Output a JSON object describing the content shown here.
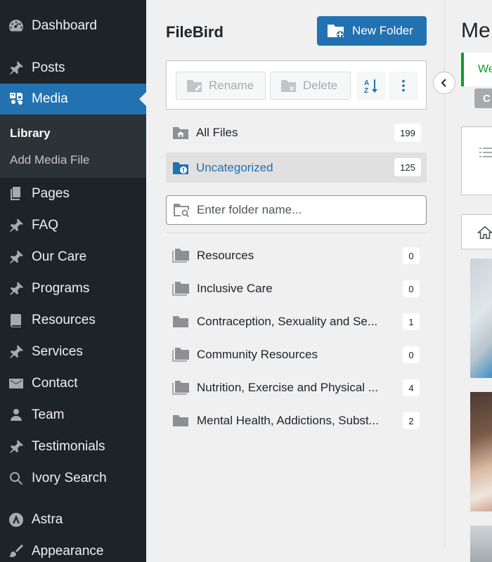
{
  "admin_menu": {
    "items": [
      {
        "label": "Dashboard",
        "icon": "dashboard-icon"
      },
      {
        "label": "Posts",
        "icon": "pin-icon"
      },
      {
        "label": "Media",
        "icon": "media-icon"
      },
      {
        "label": "Pages",
        "icon": "pages-icon"
      },
      {
        "label": "FAQ",
        "icon": "pin-icon"
      },
      {
        "label": "Our Care",
        "icon": "pin-icon"
      },
      {
        "label": "Programs",
        "icon": "pin-icon"
      },
      {
        "label": "Resources",
        "icon": "book-icon"
      },
      {
        "label": "Services",
        "icon": "pin-icon"
      },
      {
        "label": "Contact",
        "icon": "mail-icon"
      },
      {
        "label": "Team",
        "icon": "user-icon"
      },
      {
        "label": "Testimonials",
        "icon": "pin-icon"
      },
      {
        "label": "Ivory Search",
        "icon": "search-icon"
      },
      {
        "label": "Astra",
        "icon": "astra-icon"
      },
      {
        "label": "Appearance",
        "icon": "brush-icon"
      }
    ],
    "active": "Media",
    "submenu": [
      {
        "label": "Library",
        "current": true
      },
      {
        "label": "Add Media File",
        "current": false
      }
    ]
  },
  "filebird": {
    "title": "FileBird",
    "new_folder_label": "New Folder",
    "toolbar": {
      "rename_label": "Rename",
      "delete_label": "Delete",
      "sort_icon": "sort-az-icon",
      "more_icon": "more-vertical-icon"
    },
    "all_files": {
      "label": "All Files",
      "count": "199"
    },
    "uncategorized": {
      "label": "Uncategorized",
      "count": "125"
    },
    "search_placeholder": "Enter folder name...",
    "folders": [
      {
        "name": "Resources",
        "count": "0"
      },
      {
        "name": "Inclusive Care",
        "count": "0"
      },
      {
        "name": "Contraception, Sexuality and Se...",
        "count": "1"
      },
      {
        "name": "Community Resources",
        "count": "0"
      },
      {
        "name": "Nutrition, Exercise and Physical ...",
        "count": "4"
      },
      {
        "name": "Mental Health, Addictions, Subst...",
        "count": "2"
      }
    ]
  },
  "media_area": {
    "title_partial": "Me",
    "notice_partial": "We",
    "pill_partial": "C"
  },
  "colors": {
    "admin_bg": "#1d2327",
    "accent": "#2271b1",
    "notice_green": "#00a32a"
  }
}
